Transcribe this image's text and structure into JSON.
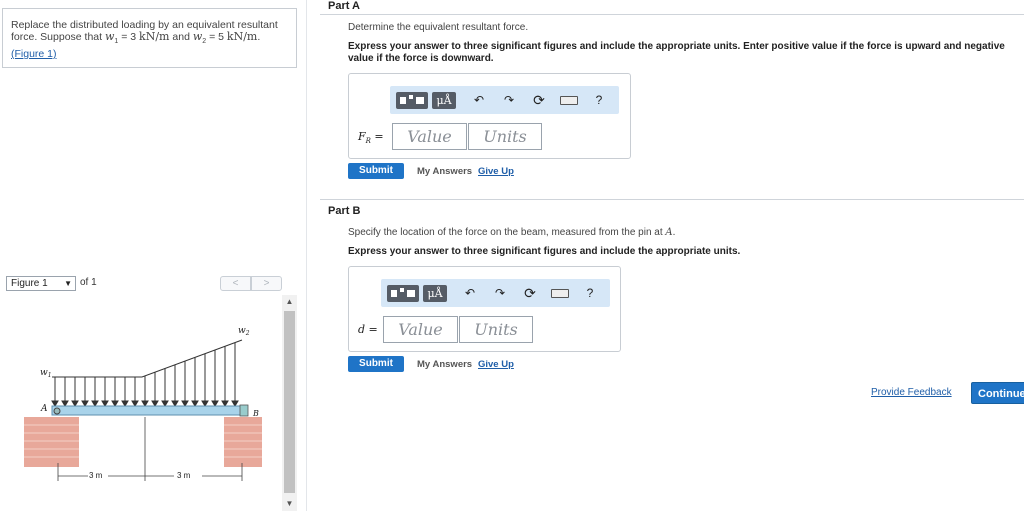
{
  "problem": {
    "text_prefix": "Replace the distributed loading by an equivalent resultant force. Suppose that ",
    "w1_symbol": "w",
    "w1_sub": "1",
    "w1_value": " = 3 ",
    "w1_unit": "kN/m",
    "mid": " and ",
    "w2_symbol": "w",
    "w2_sub": "2",
    "w2_value": " = 5 ",
    "w2_unit": "kN/m",
    "end": ".",
    "figure_link": "(Figure 1)"
  },
  "figure_toolbar": {
    "selected": "Figure 1",
    "of_label": "of 1",
    "prev": "<",
    "next": ">"
  },
  "figure": {
    "label_w1": "w",
    "label_w1_sub": "1",
    "label_w2": "w",
    "label_w2_sub": "2",
    "label_A": "A",
    "label_B": "B",
    "dim_left": "3 m",
    "dim_right": "3 m"
  },
  "partA": {
    "title": "Part A",
    "instruction": "Determine the equivalent resultant force.",
    "bold_instruction": "Express your answer to three significant figures and include the appropriate units. Enter positive value if the force is upward and negative value if the force is downward.",
    "label_symbol": "F",
    "label_sub": "R",
    "label_eq": " =",
    "value_placeholder": "Value",
    "units_placeholder": "Units",
    "submit": "Submit",
    "my_answers": "My Answers",
    "give_up": "Give Up"
  },
  "partB": {
    "title": "Part B",
    "instruction_prefix": "Specify the location of the force on the beam, measured from the pin at ",
    "instruction_symbol": "A",
    "instruction_end": ".",
    "bold_instruction": "Express your answer to three significant figures and include the appropriate units.",
    "label_symbol": "d",
    "label_eq": " =",
    "value_placeholder": "Value",
    "units_placeholder": "Units",
    "submit": "Submit",
    "my_answers": "My Answers",
    "give_up": "Give Up"
  },
  "toolbar": {
    "mu_label": "μÅ",
    "help": "?"
  },
  "footer": {
    "feedback": "Provide Feedback",
    "continue": "Continue"
  }
}
